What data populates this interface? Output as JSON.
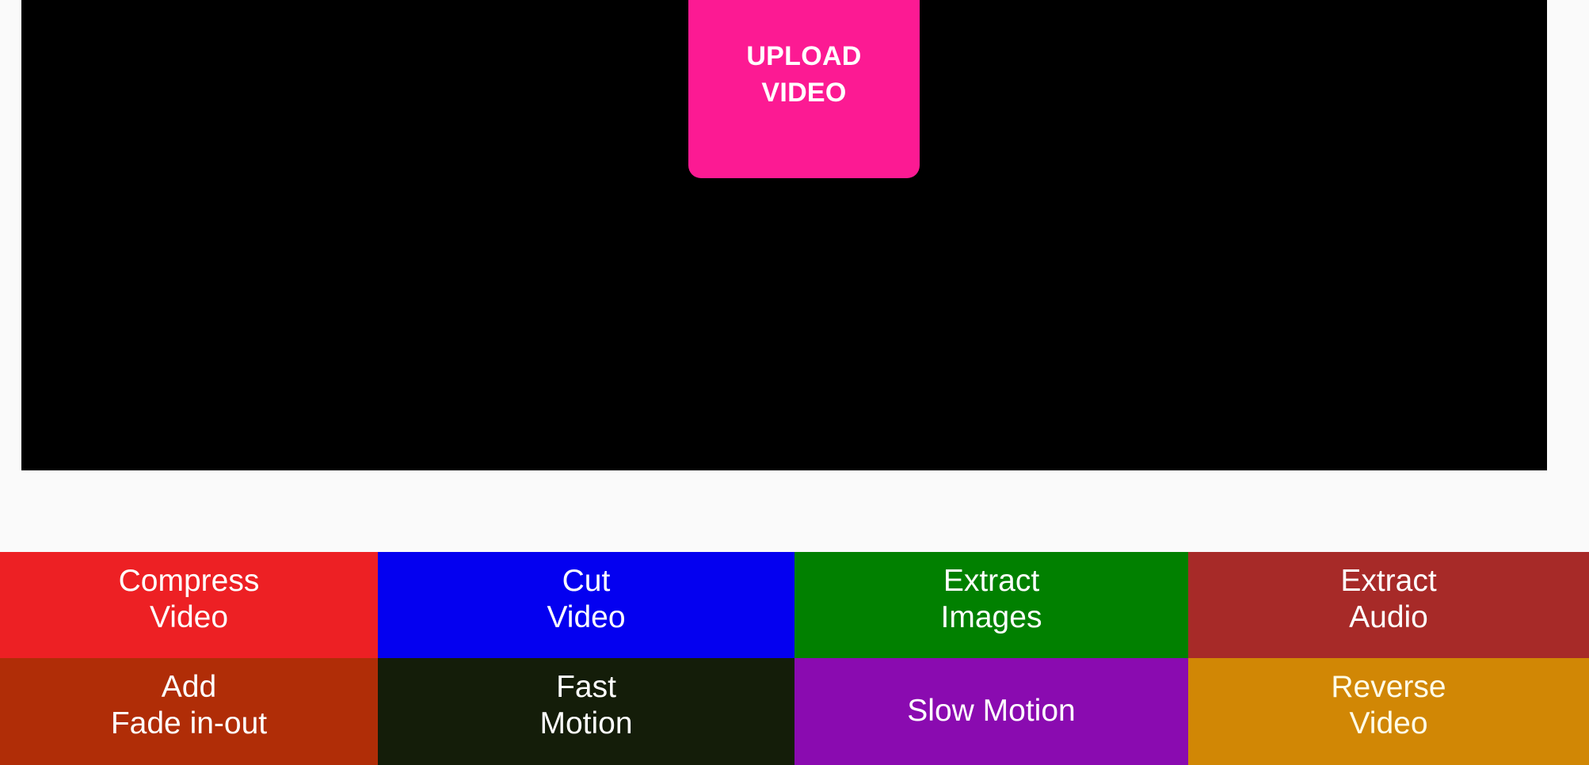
{
  "app": {
    "background_color": "#fafafa"
  },
  "video_stage": {
    "name": "video-preview",
    "background_color": "#000000"
  },
  "upload": {
    "label_line1": "UPLOAD",
    "label_line2": "VIDEO",
    "background_color": "#fc1a93",
    "text_color": "#ffffff"
  },
  "tools": [
    {
      "id": "compress-video",
      "line1": "Compress",
      "line2": "Video",
      "color": "#ed2024",
      "text_color": "#ffffff",
      "single_line": false
    },
    {
      "id": "cut-video",
      "line1": "Cut",
      "line2": "Video",
      "color": "#0400f0",
      "text_color": "#ffffff",
      "single_line": false
    },
    {
      "id": "extract-images",
      "line1": "Extract",
      "line2": "Images",
      "color": "#018000",
      "text_color": "#ffffff",
      "single_line": false
    },
    {
      "id": "extract-audio",
      "line1": "Extract",
      "line2": "Audio",
      "color": "#a72a28",
      "text_color": "#ffffff",
      "single_line": false
    },
    {
      "id": "add-fade-in-out",
      "line1": "Add",
      "line2": "Fade in-out",
      "color": "#b02d07",
      "text_color": "#ffffff",
      "single_line": false
    },
    {
      "id": "fast-motion",
      "line1": "Fast",
      "line2": "Motion",
      "color": "#141d09",
      "text_color": "#ffffff",
      "single_line": false
    },
    {
      "id": "slow-motion",
      "line1": "Slow Motion",
      "line2": "",
      "color": "#8a0bb0",
      "text_color": "#ffffff",
      "single_line": true
    },
    {
      "id": "reverse-video",
      "line1": "Reverse",
      "line2": "Video",
      "color": "#d18705",
      "text_color": "#fffde8",
      "single_line": false
    }
  ]
}
